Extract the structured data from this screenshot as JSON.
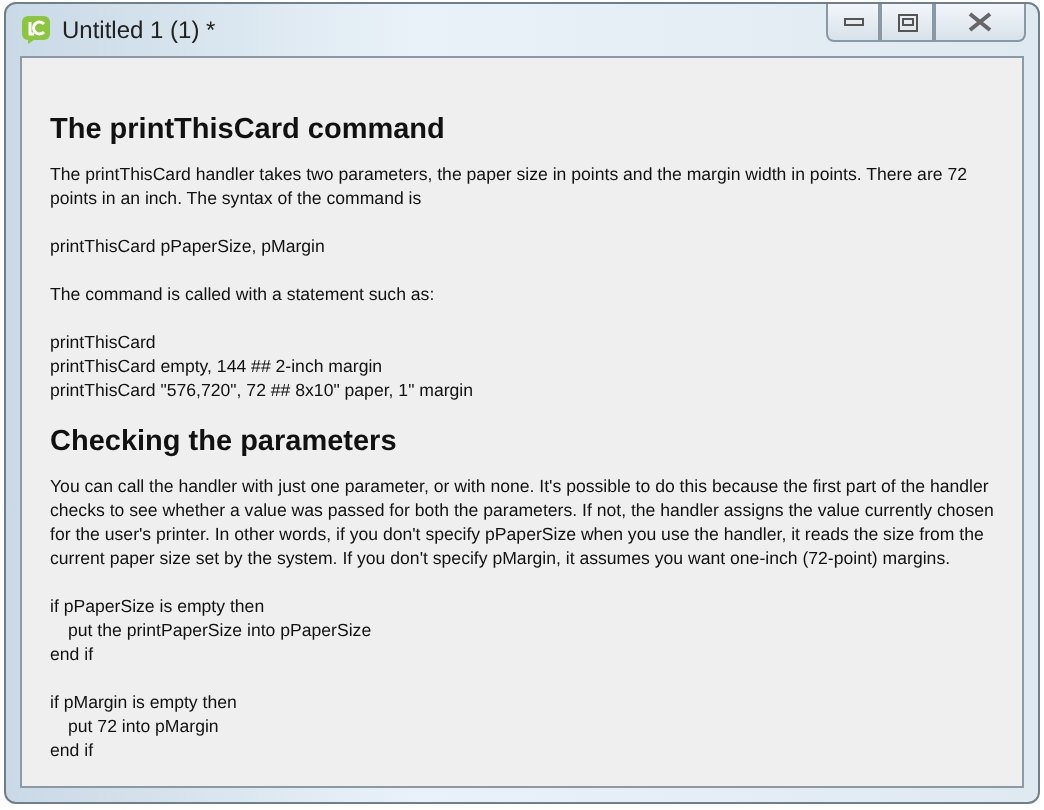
{
  "window": {
    "title": "Untitled 1 (1) *"
  },
  "blocks": [
    {
      "kind": "heading",
      "text": "The printThisCard command"
    },
    {
      "kind": "paragraph",
      "text": "The printThisCard handler takes two parameters, the paper size in points and the margin width in points. There are 72 points in an inch. The syntax of the command is"
    },
    {
      "kind": "code",
      "lines": [
        {
          "text": "printThisCard pPaperSize, pMargin",
          "indented": false
        }
      ]
    },
    {
      "kind": "paragraph",
      "text": "The command is called with a statement such as:"
    },
    {
      "kind": "code",
      "lines": [
        {
          "text": "printThisCard",
          "indented": false
        },
        {
          "text": "printThisCard empty, 144 ## 2-inch margin",
          "indented": false
        },
        {
          "text": "printThisCard \"576,720\", 72 ## 8x10\" paper, 1\" margin",
          "indented": false
        }
      ]
    },
    {
      "kind": "heading",
      "text": "Checking the parameters"
    },
    {
      "kind": "paragraph",
      "text": "You can call the handler with just one parameter, or with none. It's possible to do this because the first part of the handler checks to see whether a value was passed for both the parameters. If not, the handler assigns the value currently chosen for the user's printer. In other words, if you don't specify pPaperSize when you use the handler, it reads the size from the current paper size set by the system. If you don't specify pMargin, it assumes you want one-inch (72-point) margins."
    },
    {
      "kind": "code",
      "lines": [
        {
          "text": "if pPaperSize is empty then",
          "indented": false
        },
        {
          "text": "put the printPaperSize into pPaperSize",
          "indented": true
        },
        {
          "text": "end if",
          "indented": false
        }
      ]
    },
    {
      "kind": "code",
      "lines": [
        {
          "text": "if pMargin is empty then",
          "indented": false
        },
        {
          "text": "put 72 into pMargin",
          "indented": true
        },
        {
          "text": "end if",
          "indented": false
        }
      ]
    }
  ]
}
